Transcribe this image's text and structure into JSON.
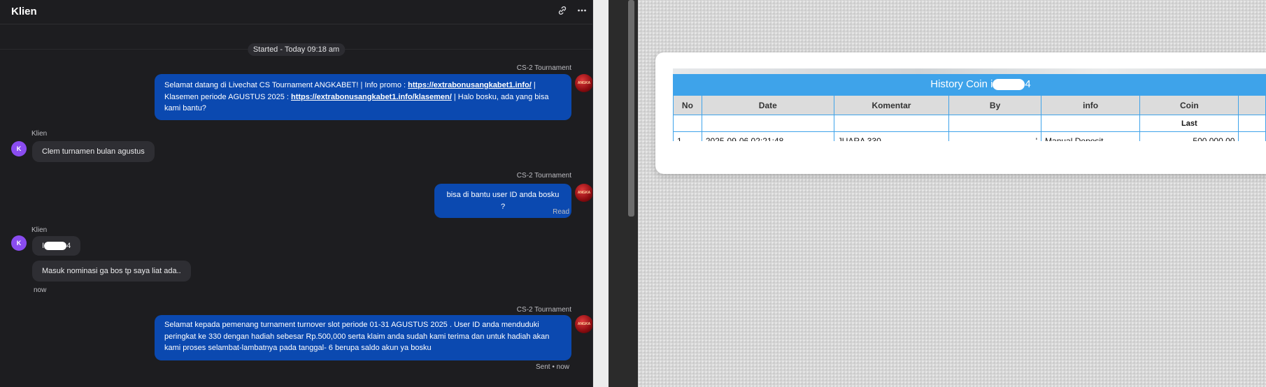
{
  "chat": {
    "title": "Klien",
    "started": "Started - Today 09:18 am",
    "messages": [
      {
        "sender": "CS-2 Tournament",
        "parts": [
          "Selamat datang di Livechat CS Tournament ANGKABET! | Info promo : ",
          "https://extrabonusangkabet1.info/",
          " | Klasemen periode AGUSTUS 2025 : ",
          "https://extrabonusangkabet1.info/klasemen/",
          " | Halo bosku, ada yang bisa kami bantu?"
        ]
      },
      {
        "sender": "Klien",
        "avatar": "K",
        "text": "Clem turnamen bulan agustus"
      },
      {
        "sender": "CS-2 Tournament",
        "text": "bisa di bantu user ID anda bosku ?",
        "status": "Read"
      },
      {
        "sender": "Klien",
        "avatar": "K",
        "text_prefix": "I",
        "text_suffix": "4",
        "text2": "Masuk nominasi ga bos tp saya liat ada..",
        "time": "now"
      },
      {
        "sender": "CS-2 Tournament",
        "text": "Selamat kepada pemenang turnament turnover slot periode 01-31 AGUSTUS 2025 . User ID anda menduduki peringkat ke 330 dengan hadiah sebesar Rp.500,000 serta klaim anda sudah kami terima dan untuk hadiah akan kami proses selambat-lambatnya pada tanggal- 6 berupa saldo akun ya bosku",
        "status": "Sent • now"
      }
    ],
    "agent_avatar_text": "ANGKA"
  },
  "history": {
    "title_prefix": "History Coin i",
    "title_suffix": "4",
    "columns": [
      "No",
      "Date",
      "Komentar",
      "By",
      "info",
      "Coin"
    ],
    "sub_header": "Last",
    "rows": [
      {
        "no": "1",
        "date": "2025-09-06 02:21:48",
        "komentar": "JUARA 330",
        "by": "'",
        "info": "Manual Deposit",
        "coin": "500,000.00"
      }
    ]
  }
}
